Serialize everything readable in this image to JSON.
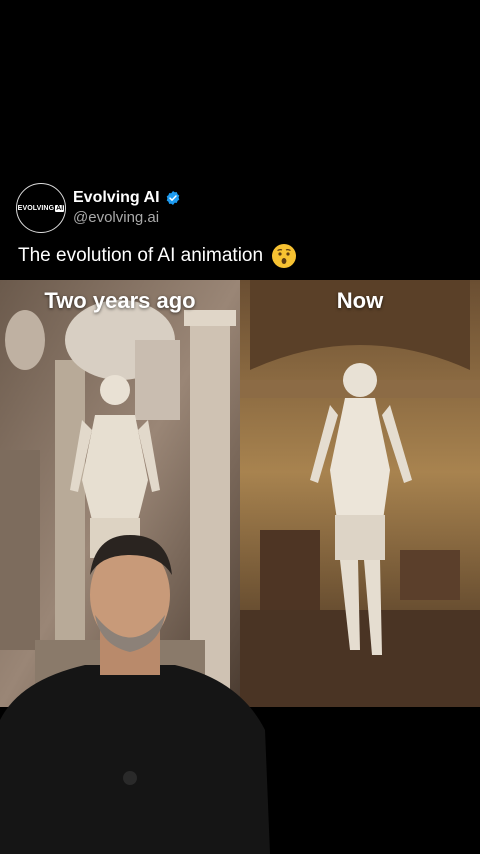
{
  "post": {
    "display_name": "Evolving AI",
    "handle": "@evolving.ai",
    "avatar_text": "EVOLVING",
    "avatar_badge": "AI",
    "verified_icon": "verified-badge-icon",
    "text": "The evolution of AI animation",
    "emoji": "hushed-face-emoji-icon"
  },
  "media": {
    "left_label": "Two years ago",
    "right_label": "Now"
  },
  "colors": {
    "background": "#000000",
    "verified": "#1d9bf0",
    "handle": "#a9a9a9"
  }
}
